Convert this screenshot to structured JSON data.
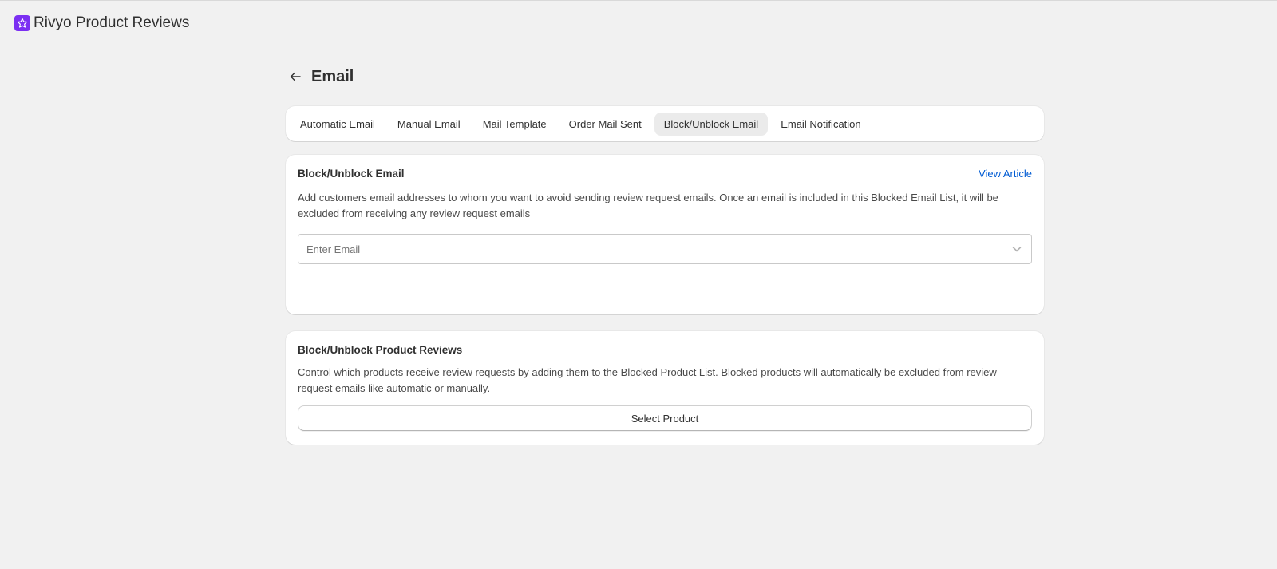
{
  "app": {
    "title": "Rivyo Product Reviews",
    "icon": "star-icon",
    "icon_color": "#7b2ff2"
  },
  "page": {
    "title": "Email",
    "back_icon": "arrow-left-icon"
  },
  "tabs": [
    {
      "label": "Automatic Email",
      "active": false
    },
    {
      "label": "Manual Email",
      "active": false
    },
    {
      "label": "Mail Template",
      "active": false
    },
    {
      "label": "Order Mail Sent",
      "active": false
    },
    {
      "label": "Block/Unblock Email",
      "active": true
    },
    {
      "label": "Email Notification",
      "active": false
    }
  ],
  "block_email": {
    "title": "Block/Unblock Email",
    "link": "View Article",
    "description": "Add customers email addresses to whom you want to avoid sending review request emails. Once an email is included in this Blocked Email List, it will be excluded from receiving any review request emails",
    "input_placeholder": "Enter Email",
    "input_value": ""
  },
  "block_product": {
    "title": "Block/Unblock Product Reviews",
    "description": "Control which products receive review requests by adding them to the Blocked Product List. Blocked products will automatically be excluded from review request emails like automatic or manually.",
    "button_label": "Select Product"
  },
  "colors": {
    "link": "#005bd3",
    "background": "#f1f1f1",
    "active_tab": "#ebebeb"
  }
}
